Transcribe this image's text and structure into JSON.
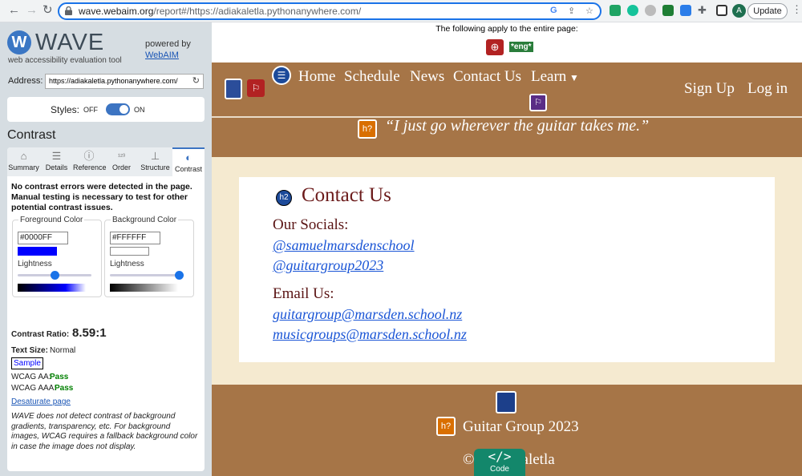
{
  "browser": {
    "url_host": "wave.webaim.org",
    "url_rest": "/report#/https://adiakaletla.pythonanywhere.com/",
    "update_label": "Update",
    "avatar_letter": "A"
  },
  "sidebar": {
    "logo_text": "WAVE",
    "tagline": "web accessibility evaluation tool",
    "powered_by": "powered by",
    "webaim_link": "WebAIM",
    "address_label": "Address:",
    "address_value": "https://adiakaletla.pythonanywhere.com/",
    "styles_label": "Styles:",
    "styles_off": "OFF",
    "styles_on": "ON",
    "panel_title": "Contrast",
    "tabs": [
      {
        "label": "Summary",
        "icon": "home-icon"
      },
      {
        "label": "Details",
        "icon": "list-icon"
      },
      {
        "label": "Reference",
        "icon": "info-icon"
      },
      {
        "label": "Order",
        "icon": "order-icon"
      },
      {
        "label": "Structure",
        "icon": "structure-icon"
      },
      {
        "label": "Contrast",
        "icon": "contrast-icon"
      }
    ],
    "contrast": {
      "message": "No contrast errors were detected in the page. Manual testing is necessary to test for other potential contrast issues.",
      "foreground_label": "Foreground Color",
      "foreground_value": "#0000FF",
      "background_label": "Background Color",
      "background_value": "#FFFFFF",
      "lightness_label": "Lightness",
      "foreground_lightness": 0.5,
      "background_lightness": 1.0,
      "ratio_label": "Contrast Ratio:",
      "ratio_value": "8.59:1",
      "text_size_label": "Text Size:",
      "text_size_value": "Normal",
      "sample_label": "Sample",
      "wcag_aa_label": "WCAG AA:",
      "wcag_aa_value": "Pass",
      "wcag_aaa_label": "WCAG AAA:",
      "wcag_aaa_value": "Pass",
      "desaturate_link": "Desaturate page",
      "note": "WAVE does not detect contrast of background gradients, transparency, etc. For background images, WCAG requires a fallback background color in case the image does not display."
    }
  },
  "page": {
    "apply_text": "The following apply to the entire page:",
    "lang_badge": "*eng*",
    "nav_items": [
      "Home",
      "Schedule",
      "News",
      "Contact Us",
      "Learn"
    ],
    "nav_right": [
      "Sign Up",
      "Log in"
    ],
    "quote": "“I just go wherever the guitar takes me.”",
    "contact_title": "Contact Us",
    "h2_badge": "h2",
    "h_unknown_badge": "h?",
    "socials_label": "Our Socials:",
    "socials": [
      "@samuelmarsdenschool",
      "@guitargroup2023"
    ],
    "email_label": "Email Us:",
    "emails": [
      "guitargroup@marsden.school.nz",
      "musicgroups@marsden.school.nz"
    ],
    "footer_title": "Guitar Group 2023",
    "copyright": "© Adia Kaletla",
    "code_button": "Code",
    "code_icon": "</>"
  },
  "colors": {
    "brown": "#a67547",
    "cream": "#f5ead0",
    "link_blue": "#1a55d6",
    "heading_maroon": "#6b1a1a",
    "wave_blue": "#3c74c2"
  }
}
